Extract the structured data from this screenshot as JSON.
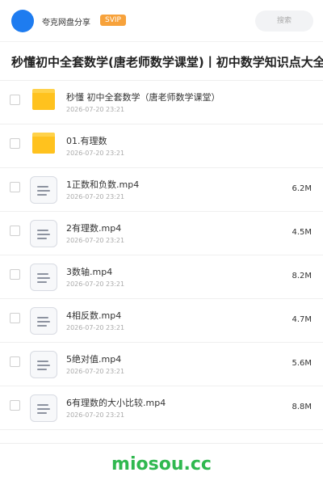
{
  "header": {
    "share_name": "夸克网盘分享",
    "badge": "SVIP",
    "search_label": "搜索",
    "accent_color": "#1e7cf0",
    "badge_color": "#f7a23b"
  },
  "title": "秒懂初中全套数学(唐老师数学课堂)丨初中数学知识点大全",
  "files": [
    {
      "type": "folder",
      "name": "秒懂 初中全套数学（唐老师数学课堂）",
      "time": "2026-07-20 23:21",
      "size": "",
      "icon": "folder-icon"
    },
    {
      "type": "folder",
      "name": "01.有理数",
      "time": "2026-07-20 23:21",
      "size": "",
      "icon": "folder-icon"
    },
    {
      "type": "file",
      "name": "1正数和负数.mp4",
      "time": "2026-07-20 23:21",
      "size": "6.2M",
      "icon": "video-file-icon"
    },
    {
      "type": "file",
      "name": "2有理数.mp4",
      "time": "2026-07-20 23:21",
      "size": "4.5M",
      "icon": "video-file-icon"
    },
    {
      "type": "file",
      "name": "3数轴.mp4",
      "time": "2026-07-20 23:21",
      "size": "8.2M",
      "icon": "video-file-icon"
    },
    {
      "type": "file",
      "name": "4相反数.mp4",
      "time": "2026-07-20 23:21",
      "size": "4.7M",
      "icon": "video-file-icon"
    },
    {
      "type": "file",
      "name": "5绝对值.mp4",
      "time": "2026-07-20 23:21",
      "size": "5.6M",
      "icon": "video-file-icon"
    },
    {
      "type": "file",
      "name": "6有理数的大小比较.mp4",
      "time": "2026-07-20 23:21",
      "size": "8.8M",
      "icon": "video-file-icon"
    }
  ],
  "footer": {
    "brand": "miosou.cc",
    "brand_color": "#2fb84f"
  }
}
